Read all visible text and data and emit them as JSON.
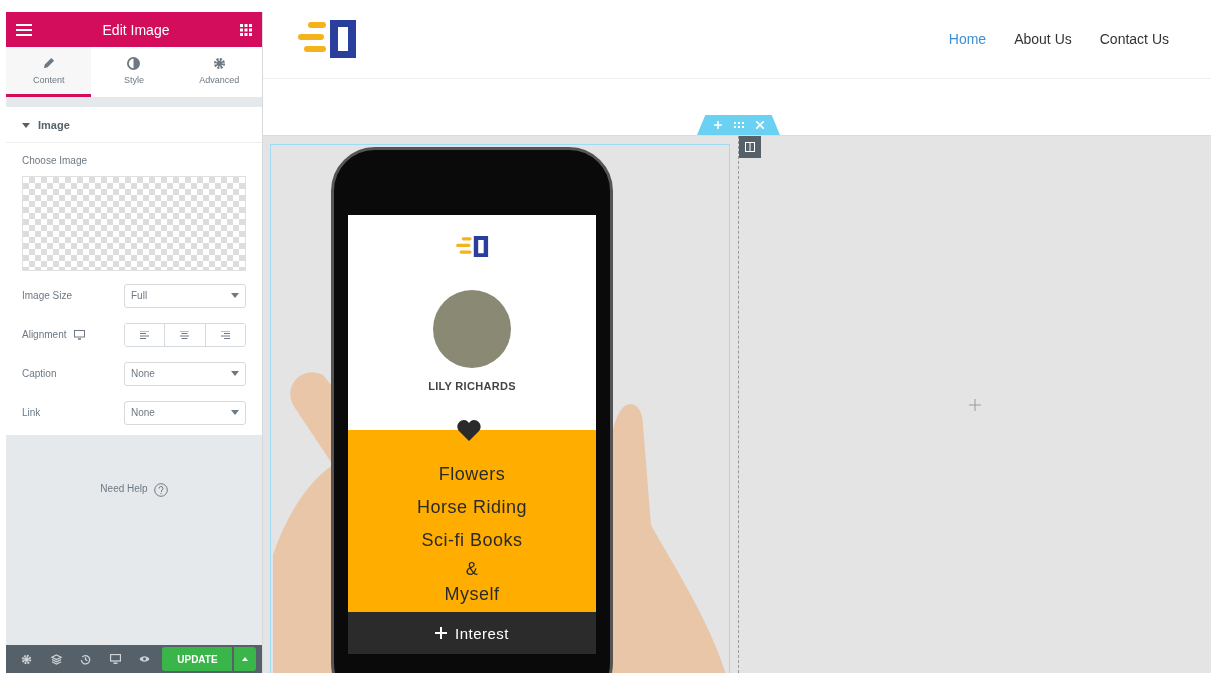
{
  "panel": {
    "title": "Edit Image",
    "tabs": [
      {
        "label": "Content",
        "selected": true
      },
      {
        "label": "Style",
        "selected": false
      },
      {
        "label": "Advanced",
        "selected": false
      }
    ],
    "section": {
      "title": "Image",
      "expanded": true
    },
    "choose_label": "Choose Image",
    "controls": [
      {
        "kind": "select",
        "label": "Image Size",
        "value": "Full"
      },
      {
        "kind": "alignment",
        "label": "Alignment"
      },
      {
        "kind": "select",
        "label": "Caption",
        "value": "None"
      },
      {
        "kind": "select",
        "label": "Link",
        "value": "None"
      }
    ],
    "help": "Need Help",
    "update": "UPDATE"
  },
  "site": {
    "nav": [
      {
        "label": "Home",
        "selected": true
      },
      {
        "label": "About Us",
        "selected": false
      },
      {
        "label": "Contact Us",
        "selected": false
      }
    ]
  },
  "phone": {
    "name": "LILY RICHARDS",
    "interests": [
      "Flowers",
      "Horse Riding",
      "Sci-fi Books",
      "&",
      "Myself"
    ],
    "button": "Interest"
  }
}
